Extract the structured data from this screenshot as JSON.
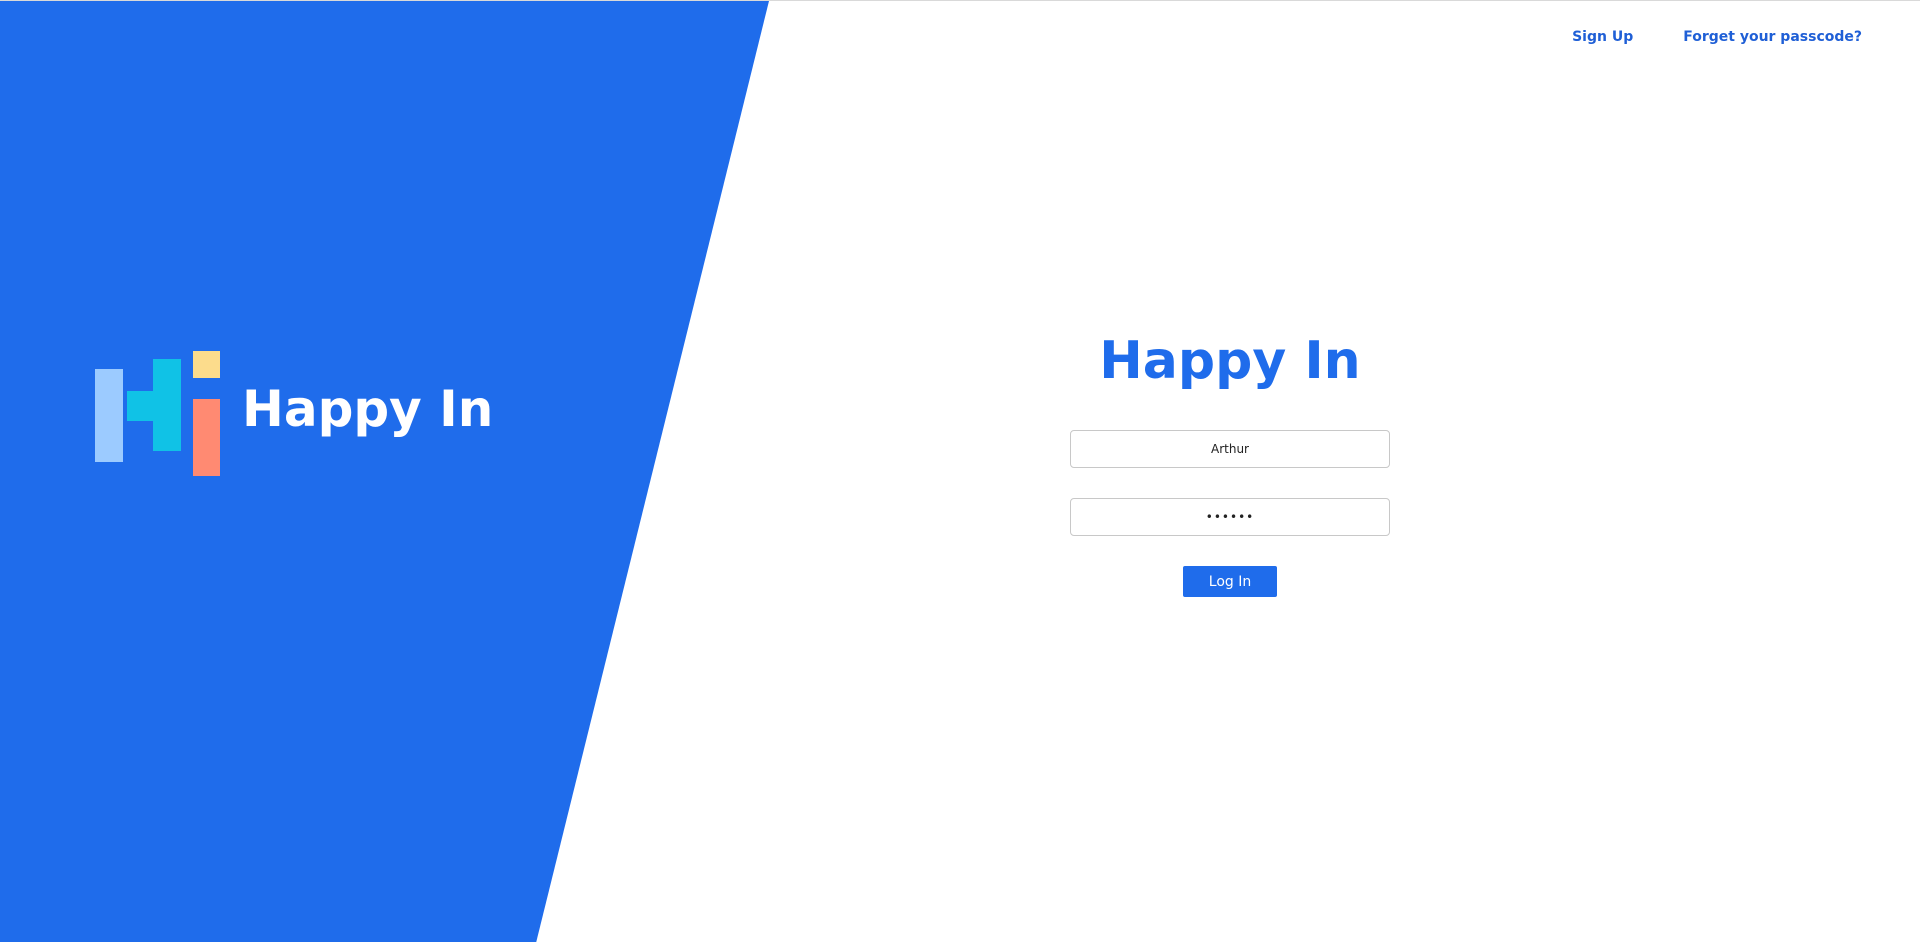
{
  "brand": {
    "name": "Happy In",
    "logo_icon": "hi-logo-icon"
  },
  "header": {
    "sign_up_label": "Sign Up",
    "forgot_label": "Forget your passcode?"
  },
  "login": {
    "title": "Happy In",
    "username_value": "Arthur",
    "password_value": "••••••",
    "button_label": "Log In"
  },
  "colors": {
    "primary_blue": "#1f6ceb",
    "link_blue": "#1f5fd6",
    "logo_light_blue": "#9ccbff",
    "logo_cyan": "#10c2e6",
    "logo_yellow": "#fcdc8c",
    "logo_salmon": "#ff8a72"
  }
}
